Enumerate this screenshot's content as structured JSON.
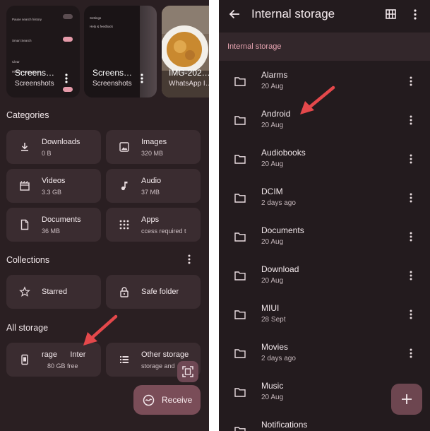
{
  "left": {
    "recent": [
      {
        "title": "Screens…",
        "subtitle": "Screenshots"
      },
      {
        "title": "Screens…",
        "subtitle": "Screenshots"
      },
      {
        "title": "IMG-202…",
        "subtitle": "WhatsApp I…"
      }
    ],
    "mini_settings_1": {
      "items": [
        "Pause search history",
        "Smart Search",
        "Clear",
        "Hidden suggestions"
      ],
      "overlay": "Screenshots"
    },
    "mini_settings_2": {
      "items": [
        "Settings",
        "Help & feedback"
      ]
    },
    "categories_title": "Categories",
    "categories": [
      {
        "label": "Downloads",
        "sub": "0 B"
      },
      {
        "label": "Images",
        "sub": "320 MB"
      },
      {
        "label": "Videos",
        "sub": "3.3 GB"
      },
      {
        "label": "Audio",
        "sub": "37 MB"
      },
      {
        "label": "Documents",
        "sub": "36 MB"
      },
      {
        "label": "Apps",
        "sub": "ccess required t"
      }
    ],
    "collections_title": "Collections",
    "collections": [
      {
        "label": "Starred"
      },
      {
        "label": "Safe folder"
      }
    ],
    "all_storage_title": "All storage",
    "storage": [
      {
        "label": "rage      Inter",
        "sub": "80 GB free"
      },
      {
        "label": "Other storage",
        "sub": "storage and"
      }
    ],
    "receive_label": "Receive"
  },
  "right": {
    "title": "Internal storage",
    "breadcrumb": "Internal storage",
    "rows": [
      {
        "name": "Alarms",
        "date": "20 Aug"
      },
      {
        "name": "Android",
        "date": "20 Aug"
      },
      {
        "name": "Audiobooks",
        "date": "20 Aug"
      },
      {
        "name": "DCIM",
        "date": "2 days ago"
      },
      {
        "name": "Documents",
        "date": "20 Aug"
      },
      {
        "name": "Download",
        "date": "20 Aug"
      },
      {
        "name": "MIUI",
        "date": "28 Sept"
      },
      {
        "name": "Movies",
        "date": "2 days ago"
      },
      {
        "name": "Music",
        "date": "20 Aug"
      },
      {
        "name": "Notifications",
        "date": ""
      }
    ]
  },
  "colors": {
    "accent": "#e4484b",
    "breadcrumb": "#e7a4b1",
    "tile": "#3a2c30",
    "receive": "#7a4d58"
  }
}
